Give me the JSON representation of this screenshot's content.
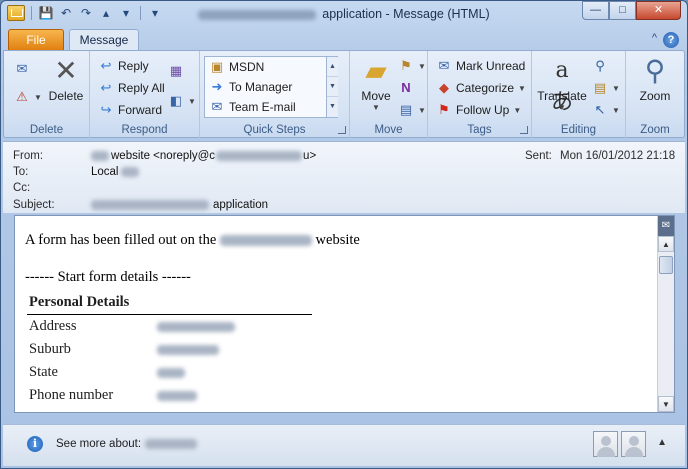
{
  "window": {
    "title_suffix": "application - Message (HTML)",
    "minimize": "—",
    "maximize": "□",
    "close": "✕"
  },
  "qat": {
    "save": "💾",
    "undo": "↶",
    "redo": "↷",
    "up": "▴",
    "down": "▾",
    "customize": "▾"
  },
  "tabs": {
    "file": "File",
    "message": "Message",
    "collapse": "^",
    "help": "?"
  },
  "ribbon": {
    "delete_group": {
      "label": "Delete",
      "delete": "Delete"
    },
    "respond_group": {
      "label": "Respond",
      "reply": "Reply",
      "reply_all": "Reply All",
      "forward": "Forward"
    },
    "quicksteps_group": {
      "label": "Quick Steps",
      "items": [
        "MSDN",
        "To Manager",
        "Team E-mail"
      ]
    },
    "move_group": {
      "label": "Move",
      "move": "Move"
    },
    "tags_group": {
      "label": "Tags",
      "mark_unread": "Mark Unread",
      "categorize": "Categorize",
      "follow_up": "Follow Up"
    },
    "editing_group": {
      "label": "Editing",
      "translate": "Translate"
    },
    "zoom_group": {
      "label": "Zoom",
      "zoom": "Zoom"
    }
  },
  "header": {
    "from_label": "From:",
    "from_value_part": "website <noreply@c",
    "from_value_end": "u>",
    "sent_label": "Sent:",
    "sent_value": "Mon 16/01/2012 21:18",
    "to_label": "To:",
    "to_value": "Local",
    "cc_label": "Cc:",
    "subject_label": "Subject:",
    "subject_value_end": "application"
  },
  "body": {
    "intro_prefix": "A form has been filled out on the",
    "intro_suffix": "website",
    "start_line": "------ Start form details ------",
    "section_title": "Personal Details",
    "rows": [
      "Address",
      "Suburb",
      "State",
      "Phone number"
    ]
  },
  "people_pane": {
    "see_more": "See more about:"
  }
}
